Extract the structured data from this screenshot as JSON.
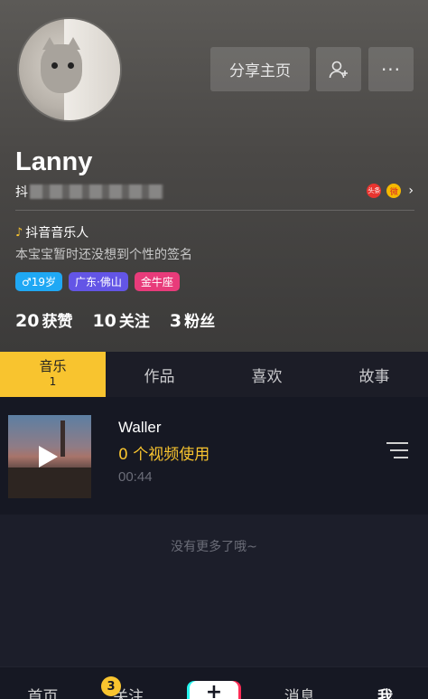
{
  "profile": {
    "name": "Lanny",
    "id_prefix": "抖",
    "role": "抖音音乐人",
    "signature": "本宝宝暂时还没想到个性的签名",
    "tags": {
      "age": "♂19岁",
      "location": "广东·佛山",
      "zodiac": "金牛座"
    },
    "stats": [
      {
        "num": "20",
        "label": "获赞"
      },
      {
        "num": "10",
        "label": "关注"
      },
      {
        "num": "3",
        "label": "粉丝"
      }
    ],
    "social": {
      "toutiao": "头条",
      "weibo": "微"
    }
  },
  "actions": {
    "share": "分享主页",
    "add_friend_icon": "add-user-icon",
    "more": "···"
  },
  "tabs": [
    {
      "label": "音乐",
      "count": "1"
    },
    {
      "label": "作品"
    },
    {
      "label": "喜欢"
    },
    {
      "label": "故事"
    }
  ],
  "song": {
    "title": "Waller",
    "usage": "0 个视频使用",
    "duration": "00:44"
  },
  "empty_text": "没有更多了哦~",
  "bottom_nav": {
    "home": "首页",
    "follow": "关注",
    "follow_badge": "3",
    "plus": "+",
    "messages": "消息",
    "me": "我"
  },
  "colors": {
    "accent": "#f8c42f",
    "background": "#161823",
    "age_tag": "#1fa8f4",
    "location_tag": "#6355e6",
    "zodiac_tag": "#e83b7a"
  }
}
